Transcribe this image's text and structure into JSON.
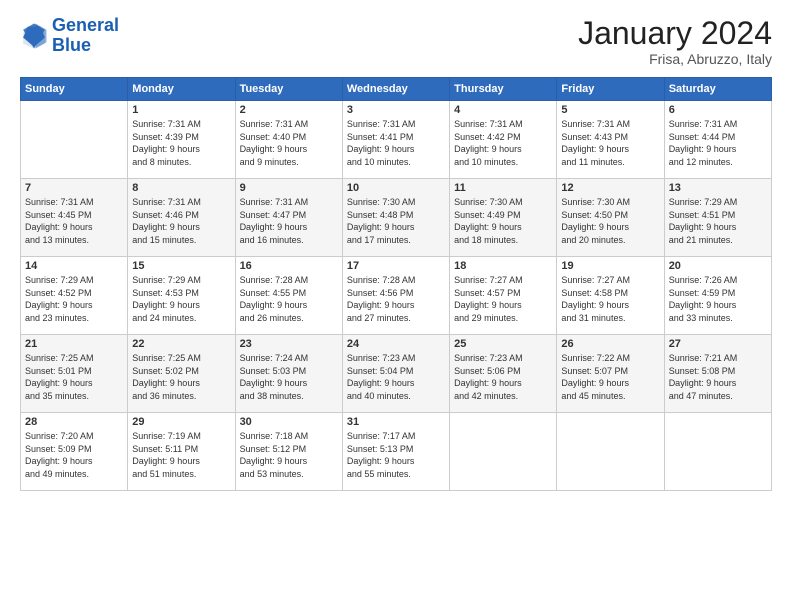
{
  "logo": {
    "line1": "General",
    "line2": "Blue"
  },
  "header": {
    "month_year": "January 2024",
    "location": "Frisa, Abruzzo, Italy"
  },
  "weekdays": [
    "Sunday",
    "Monday",
    "Tuesday",
    "Wednesday",
    "Thursday",
    "Friday",
    "Saturday"
  ],
  "weeks": [
    [
      {
        "day": "",
        "info": ""
      },
      {
        "day": "1",
        "info": "Sunrise: 7:31 AM\nSunset: 4:39 PM\nDaylight: 9 hours\nand 8 minutes."
      },
      {
        "day": "2",
        "info": "Sunrise: 7:31 AM\nSunset: 4:40 PM\nDaylight: 9 hours\nand 9 minutes."
      },
      {
        "day": "3",
        "info": "Sunrise: 7:31 AM\nSunset: 4:41 PM\nDaylight: 9 hours\nand 10 minutes."
      },
      {
        "day": "4",
        "info": "Sunrise: 7:31 AM\nSunset: 4:42 PM\nDaylight: 9 hours\nand 10 minutes."
      },
      {
        "day": "5",
        "info": "Sunrise: 7:31 AM\nSunset: 4:43 PM\nDaylight: 9 hours\nand 11 minutes."
      },
      {
        "day": "6",
        "info": "Sunrise: 7:31 AM\nSunset: 4:44 PM\nDaylight: 9 hours\nand 12 minutes."
      }
    ],
    [
      {
        "day": "7",
        "info": "Sunrise: 7:31 AM\nSunset: 4:45 PM\nDaylight: 9 hours\nand 13 minutes."
      },
      {
        "day": "8",
        "info": "Sunrise: 7:31 AM\nSunset: 4:46 PM\nDaylight: 9 hours\nand 15 minutes."
      },
      {
        "day": "9",
        "info": "Sunrise: 7:31 AM\nSunset: 4:47 PM\nDaylight: 9 hours\nand 16 minutes."
      },
      {
        "day": "10",
        "info": "Sunrise: 7:30 AM\nSunset: 4:48 PM\nDaylight: 9 hours\nand 17 minutes."
      },
      {
        "day": "11",
        "info": "Sunrise: 7:30 AM\nSunset: 4:49 PM\nDaylight: 9 hours\nand 18 minutes."
      },
      {
        "day": "12",
        "info": "Sunrise: 7:30 AM\nSunset: 4:50 PM\nDaylight: 9 hours\nand 20 minutes."
      },
      {
        "day": "13",
        "info": "Sunrise: 7:29 AM\nSunset: 4:51 PM\nDaylight: 9 hours\nand 21 minutes."
      }
    ],
    [
      {
        "day": "14",
        "info": "Sunrise: 7:29 AM\nSunset: 4:52 PM\nDaylight: 9 hours\nand 23 minutes."
      },
      {
        "day": "15",
        "info": "Sunrise: 7:29 AM\nSunset: 4:53 PM\nDaylight: 9 hours\nand 24 minutes."
      },
      {
        "day": "16",
        "info": "Sunrise: 7:28 AM\nSunset: 4:55 PM\nDaylight: 9 hours\nand 26 minutes."
      },
      {
        "day": "17",
        "info": "Sunrise: 7:28 AM\nSunset: 4:56 PM\nDaylight: 9 hours\nand 27 minutes."
      },
      {
        "day": "18",
        "info": "Sunrise: 7:27 AM\nSunset: 4:57 PM\nDaylight: 9 hours\nand 29 minutes."
      },
      {
        "day": "19",
        "info": "Sunrise: 7:27 AM\nSunset: 4:58 PM\nDaylight: 9 hours\nand 31 minutes."
      },
      {
        "day": "20",
        "info": "Sunrise: 7:26 AM\nSunset: 4:59 PM\nDaylight: 9 hours\nand 33 minutes."
      }
    ],
    [
      {
        "day": "21",
        "info": "Sunrise: 7:25 AM\nSunset: 5:01 PM\nDaylight: 9 hours\nand 35 minutes."
      },
      {
        "day": "22",
        "info": "Sunrise: 7:25 AM\nSunset: 5:02 PM\nDaylight: 9 hours\nand 36 minutes."
      },
      {
        "day": "23",
        "info": "Sunrise: 7:24 AM\nSunset: 5:03 PM\nDaylight: 9 hours\nand 38 minutes."
      },
      {
        "day": "24",
        "info": "Sunrise: 7:23 AM\nSunset: 5:04 PM\nDaylight: 9 hours\nand 40 minutes."
      },
      {
        "day": "25",
        "info": "Sunrise: 7:23 AM\nSunset: 5:06 PM\nDaylight: 9 hours\nand 42 minutes."
      },
      {
        "day": "26",
        "info": "Sunrise: 7:22 AM\nSunset: 5:07 PM\nDaylight: 9 hours\nand 45 minutes."
      },
      {
        "day": "27",
        "info": "Sunrise: 7:21 AM\nSunset: 5:08 PM\nDaylight: 9 hours\nand 47 minutes."
      }
    ],
    [
      {
        "day": "28",
        "info": "Sunrise: 7:20 AM\nSunset: 5:09 PM\nDaylight: 9 hours\nand 49 minutes."
      },
      {
        "day": "29",
        "info": "Sunrise: 7:19 AM\nSunset: 5:11 PM\nDaylight: 9 hours\nand 51 minutes."
      },
      {
        "day": "30",
        "info": "Sunrise: 7:18 AM\nSunset: 5:12 PM\nDaylight: 9 hours\nand 53 minutes."
      },
      {
        "day": "31",
        "info": "Sunrise: 7:17 AM\nSunset: 5:13 PM\nDaylight: 9 hours\nand 55 minutes."
      },
      {
        "day": "",
        "info": ""
      },
      {
        "day": "",
        "info": ""
      },
      {
        "day": "",
        "info": ""
      }
    ]
  ]
}
